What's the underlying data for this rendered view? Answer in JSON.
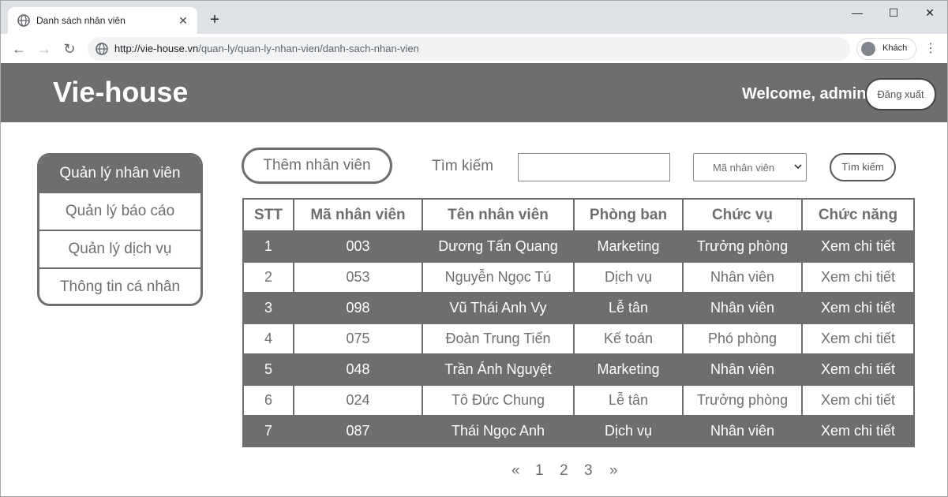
{
  "browser": {
    "tab_title": "Danh sách nhân viên",
    "tab_close": "✕",
    "new_tab": "+",
    "url_host": "http://vie-house.vn",
    "url_path": "/quan-ly/quan-ly-nhan-vien/danh-sach-nhan-vien",
    "profile_label": "Khách",
    "back": "←",
    "forward": "→",
    "reload": "↻",
    "menu": "⋮",
    "minimize": "—",
    "maximize": "☐",
    "close": "✕"
  },
  "header": {
    "brand": "Vie-house",
    "welcome": "Welcome, admin",
    "logout_label": "Đăng xuất"
  },
  "sidebar": {
    "items": [
      {
        "label": "Quản lý nhân viên",
        "active": true
      },
      {
        "label": "Quản lý báo cáo",
        "active": false
      },
      {
        "label": "Quản lý dịch vụ",
        "active": false
      },
      {
        "label": "Thông tin cá nhân",
        "active": false
      }
    ]
  },
  "controls": {
    "add_label": "Thêm nhân viên",
    "search_label": "Tìm kiếm",
    "search_value": "",
    "filter_value": "Mã nhân viên",
    "search_button": "Tìm kiếm"
  },
  "table": {
    "columns": [
      "STT",
      "Mã nhân viên",
      "Tên nhân viên",
      "Phòng ban",
      "Chức vụ",
      "Chức năng"
    ],
    "rows": [
      [
        "1",
        "003",
        "Dương Tấn Quang",
        "Marketing",
        "Trưởng phòng",
        "Xem chi tiết"
      ],
      [
        "2",
        "053",
        "Nguyễn Ngọc Tú",
        "Dịch vụ",
        "Nhân viên",
        "Xem chi tiết"
      ],
      [
        "3",
        "098",
        "Vũ Thái Anh Vy",
        "Lễ tân",
        "Nhân viên",
        "Xem chi tiết"
      ],
      [
        "4",
        "075",
        "Đoàn Trung Tiến",
        "Kế toán",
        "Phó phòng",
        "Xem chi tiết"
      ],
      [
        "5",
        "048",
        "Trần Ánh Nguyệt",
        "Marketing",
        "Nhân viên",
        "Xem chi tiết"
      ],
      [
        "6",
        "024",
        "Tô Đức Chung",
        "Lễ tân",
        "Trưởng phòng",
        "Xem chi tiết"
      ],
      [
        "7",
        "087",
        "Thái Ngọc Anh",
        "Dịch vụ",
        "Nhân viên",
        "Xem chi tiết"
      ]
    ]
  },
  "pagination": {
    "prev": "«",
    "pages": [
      "1",
      "2",
      "3"
    ],
    "next": "»"
  },
  "colors": {
    "primary_gray": "#6e6e6e",
    "white": "#ffffff"
  }
}
